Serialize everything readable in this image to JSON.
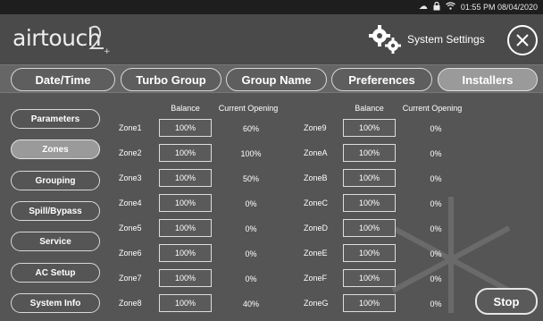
{
  "status_bar": {
    "icons": [
      "cloud-icon",
      "lock-icon",
      "wifi-icon"
    ],
    "datetime": "01:55 PM 08/04/2020"
  },
  "header": {
    "logo_text": "airtouch",
    "logo_suffix": "2",
    "settings_icon": "gears-icon",
    "settings_title": "System Settings",
    "close_icon": "close-icon"
  },
  "tabs": [
    {
      "label": "Date/Time",
      "active": false
    },
    {
      "label": "Turbo Group",
      "active": false
    },
    {
      "label": "Group Name",
      "active": false
    },
    {
      "label": "Preferences",
      "active": false
    },
    {
      "label": "Installers",
      "active": true
    }
  ],
  "sidebar": [
    {
      "label": "Parameters",
      "active": false
    },
    {
      "label": "Zones",
      "active": true
    },
    {
      "label": "Grouping",
      "active": false
    },
    {
      "label": "Spill/Bypass",
      "active": false
    },
    {
      "label": "Service",
      "active": false
    },
    {
      "label": "AC Setup",
      "active": false
    },
    {
      "label": "System Info",
      "active": false
    }
  ],
  "columns": {
    "balance": "Balance",
    "current_opening": "Current Opening"
  },
  "zones_left": [
    {
      "name": "Zone1",
      "balance": "100%",
      "opening": "60%"
    },
    {
      "name": "Zone2",
      "balance": "100%",
      "opening": "100%"
    },
    {
      "name": "Zone3",
      "balance": "100%",
      "opening": "50%"
    },
    {
      "name": "Zone4",
      "balance": "100%",
      "opening": "0%"
    },
    {
      "name": "Zone5",
      "balance": "100%",
      "opening": "0%"
    },
    {
      "name": "Zone6",
      "balance": "100%",
      "opening": "0%"
    },
    {
      "name": "Zone7",
      "balance": "100%",
      "opening": "0%"
    },
    {
      "name": "Zone8",
      "balance": "100%",
      "opening": "40%"
    }
  ],
  "zones_right": [
    {
      "name": "Zone9",
      "balance": "100%",
      "opening": "0%"
    },
    {
      "name": "ZoneA",
      "balance": "100%",
      "opening": "0%"
    },
    {
      "name": "ZoneB",
      "balance": "100%",
      "opening": "0%"
    },
    {
      "name": "ZoneC",
      "balance": "100%",
      "opening": "0%"
    },
    {
      "name": "ZoneD",
      "balance": "100%",
      "opening": "0%"
    },
    {
      "name": "ZoneE",
      "balance": "100%",
      "opening": "0%"
    },
    {
      "name": "ZoneF",
      "balance": "100%",
      "opening": "0%"
    },
    {
      "name": "ZoneG",
      "balance": "100%",
      "opening": "0%"
    }
  ],
  "stop_button": "Stop",
  "colors": {
    "background": "#555555",
    "header": "#4a4a4a",
    "active_button": "#9a9a9a",
    "border": "#d8d8d8",
    "text": "#ffffff"
  }
}
